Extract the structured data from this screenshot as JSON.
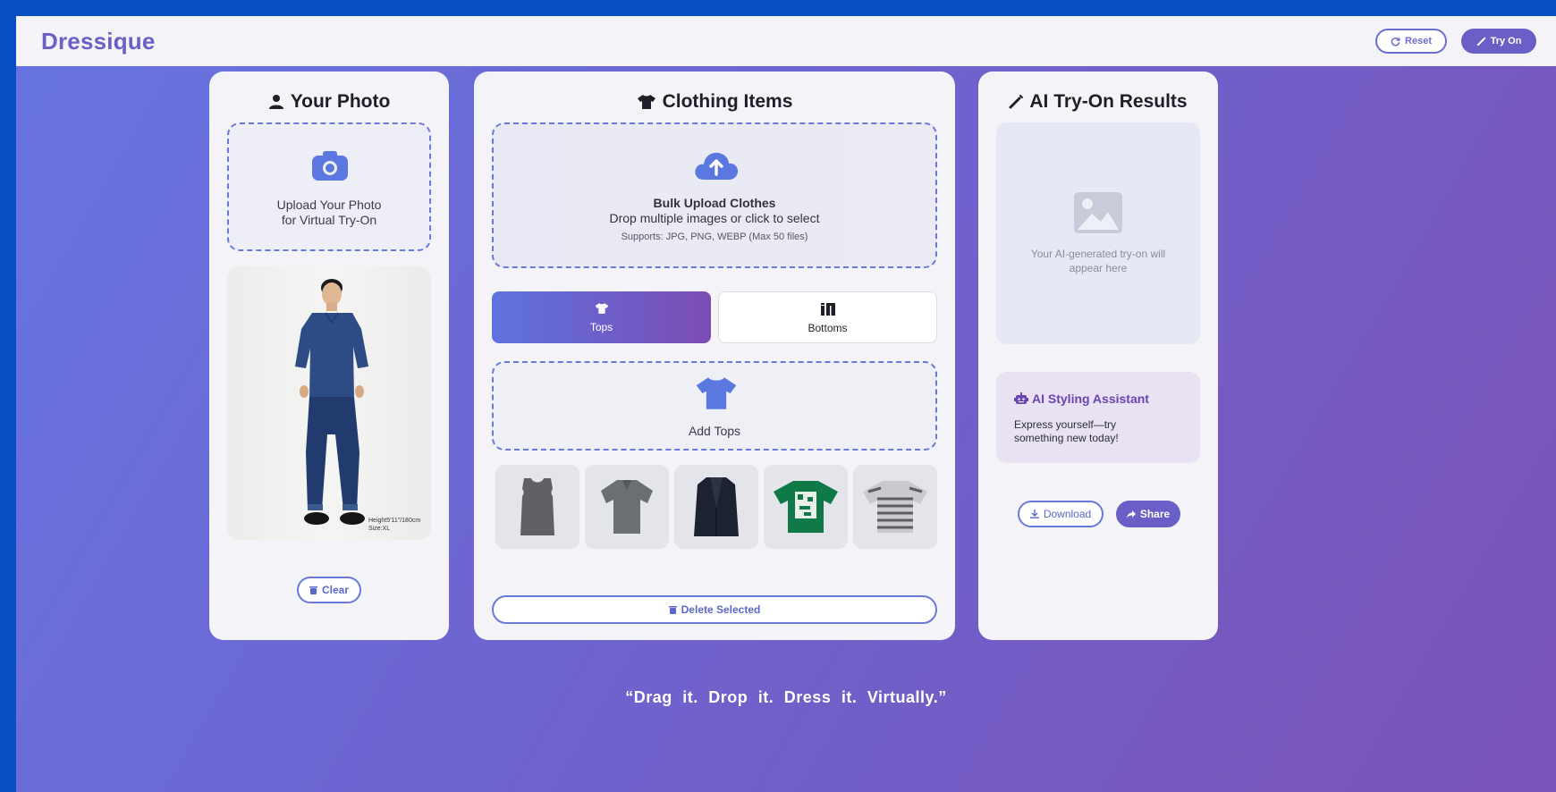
{
  "header": {
    "brand": "Dressique",
    "reset_label": "Reset",
    "tryon_label": "Try On"
  },
  "photo_panel": {
    "title": "Your Photo",
    "upload_line1": "Upload Your Photo",
    "upload_line2": "for Virtual Try-On",
    "photo_caption_line1": "Height5'11\"/180cm",
    "photo_caption_line2": "Size:XL",
    "clear_label": "Clear"
  },
  "clothing_panel": {
    "title": "Clothing Items",
    "bulk_title": "Bulk Upload Clothes",
    "bulk_sub": "Drop multiple images or click to select",
    "bulk_supports": "Supports: JPG, PNG, WEBP (Max 50 files)",
    "tabs": [
      {
        "label": "Tops",
        "active": true
      },
      {
        "label": "Bottoms",
        "active": false
      }
    ],
    "add_label": "Add Tops",
    "items": [
      {
        "name": "gray sleeveless top",
        "color": "#5f6165"
      },
      {
        "name": "gray polo shirt",
        "color": "#6b6e72"
      },
      {
        "name": "navy blazer",
        "color": "#1d2230"
      },
      {
        "name": "green graphic tee",
        "color": "#0f7a47"
      },
      {
        "name": "striped tee",
        "color": "#9a9ca0"
      }
    ],
    "delete_label": "Delete Selected"
  },
  "results_panel": {
    "title": "AI Try-On Results",
    "placeholder_line1": "Your AI-generated try-on will",
    "placeholder_line2": "appear here",
    "assistant_title": "AI Styling Assistant",
    "assistant_line1": "Express yourself—try",
    "assistant_line2": "something new today!",
    "download_label": "Download",
    "share_label": "Share"
  },
  "footer": {
    "tagline": "“Drag it. Drop it. Dress it. Virtually.”"
  },
  "colors": {
    "accent": "#6a5fc6",
    "accent_blue": "#6a79d8",
    "bg_gradient_start": "#6674e2",
    "bg_gradient_end": "#7a52b8"
  }
}
